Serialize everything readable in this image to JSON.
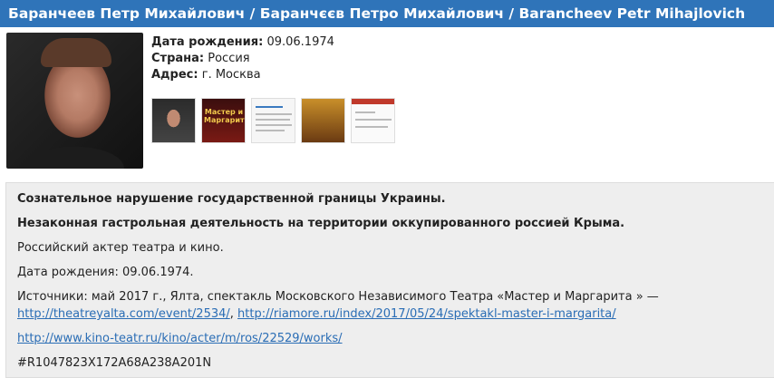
{
  "header": {
    "title": "Баранчеев Петр Михайлович / Баранчєєв Петро Михайлович / Barancheev Petr Mihajlovich"
  },
  "info": {
    "birth_label": "Дата рождения:",
    "birth_value": "09.06.1974",
    "country_label": "Страна:",
    "country_value": "Россия",
    "address_label": "Адрес:",
    "address_value": "г. Москва"
  },
  "thumbnails": {
    "t2_text": "Мастер и Маргарита"
  },
  "panel": {
    "line1": "Сознательное нарушение государственной границы Украины.",
    "line2": "Незаконная гастрольная деятельность на территории оккупированного россией Крыма.",
    "line3": "Российский актер театра и кино.",
    "line4": "Дата рождения: 09.06.1974.",
    "sources_text": "Источники: май 2017 г., Ялта, спектакль Московского Независимого Театра «Мастер и Маргарита » —",
    "link1": "http://theatreyalta.com/event/2534/",
    "sep": ", ",
    "link2": "http://riamore.ru/index/2017/05/24/spektakl-master-i-margarita/",
    "link3": "http://www.kino-teatr.ru/kino/acter/m/ros/22529/works/",
    "code": "#R1047823X172A68A238A201N"
  }
}
